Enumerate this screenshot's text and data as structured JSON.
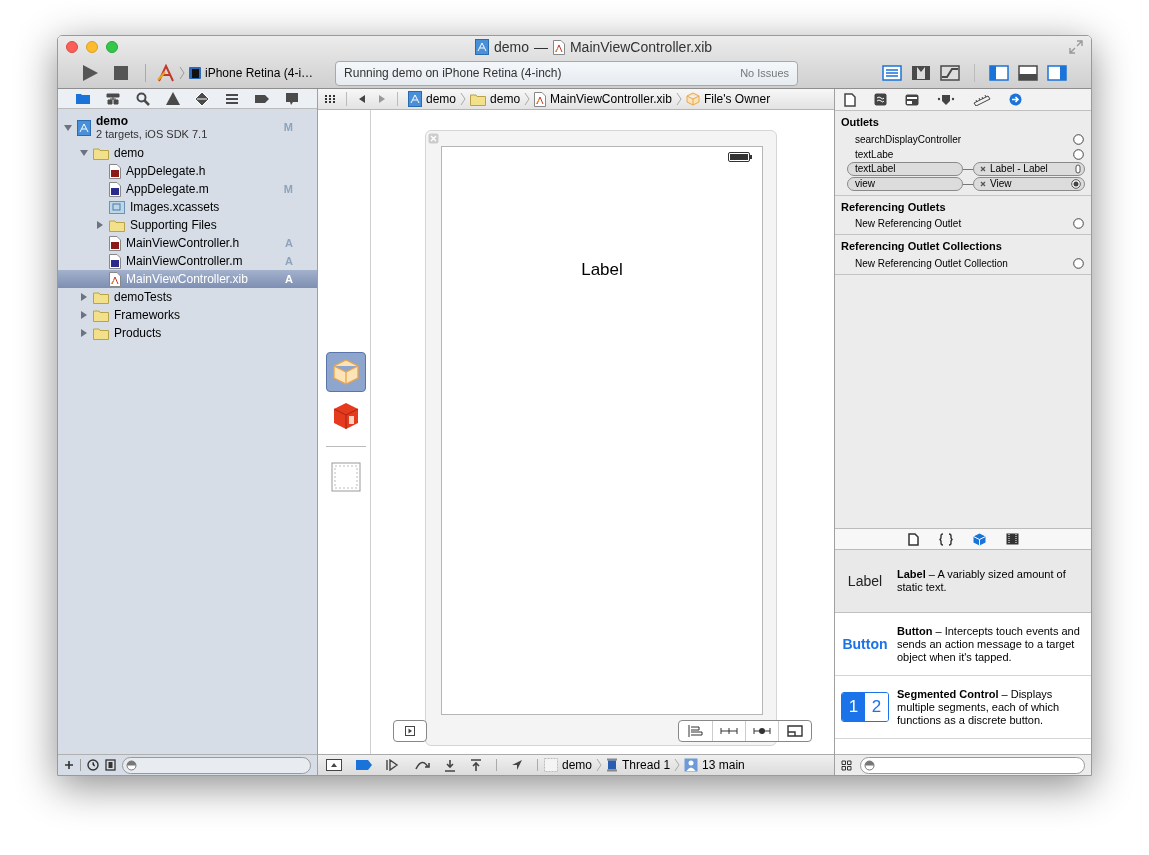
{
  "window": {
    "project": "demo",
    "separator": "—",
    "file": "MainViewController.xib"
  },
  "toolbar": {
    "scheme": "iPhone Retina (4-i…",
    "status": "Running demo on iPhone Retina (4-inch)",
    "issues": "No Issues",
    "editor_modes": [
      {
        "kind": "standard",
        "selected": true
      },
      {
        "kind": "assistant",
        "selected": false
      },
      {
        "kind": "version",
        "selected": false
      }
    ],
    "view_toggles": [
      {
        "kind": "navigator",
        "on": true
      },
      {
        "kind": "debug",
        "on": false
      },
      {
        "kind": "utilities",
        "on": true
      }
    ]
  },
  "navigator": {
    "tabs": [
      {
        "kind": "folder",
        "selected": true
      },
      {
        "kind": "hierarchy",
        "selected": false
      },
      {
        "kind": "search",
        "selected": false
      },
      {
        "kind": "warning",
        "selected": false
      },
      {
        "kind": "test",
        "selected": false
      },
      {
        "kind": "debug",
        "selected": false
      },
      {
        "kind": "breakpoint",
        "selected": false
      },
      {
        "kind": "log",
        "selected": false
      }
    ],
    "tree": [
      {
        "kind": "project",
        "name": "demo",
        "subtitle": "2 targets, iOS SDK 7.1",
        "badge": "M",
        "expanded": true,
        "selected": false,
        "children": [
          {
            "kind": "folder",
            "name": "demo",
            "expanded": true,
            "selected": false,
            "children": [
              {
                "kind": "h",
                "name": "AppDelegate.h",
                "selected": false
              },
              {
                "kind": "m",
                "name": "AppDelegate.m",
                "badge": "M",
                "selected": false
              },
              {
                "kind": "assets",
                "name": "Images.xcassets",
                "selected": false
              },
              {
                "kind": "folder",
                "name": "Supporting Files",
                "expanded": false,
                "selected": false
              },
              {
                "kind": "h",
                "name": "MainViewController.h",
                "badge": "A",
                "selected": false
              },
              {
                "kind": "m",
                "name": "MainViewController.m",
                "badge": "A",
                "selected": false
              },
              {
                "kind": "xib",
                "name": "MainViewController.xib",
                "badge": "A",
                "selected": true
              }
            ]
          },
          {
            "kind": "folder",
            "name": "demoTests",
            "expanded": false,
            "selected": false
          },
          {
            "kind": "folder",
            "name": "Frameworks",
            "expanded": false,
            "selected": false
          },
          {
            "kind": "folder",
            "name": "Products",
            "expanded": false,
            "selected": false
          }
        ]
      }
    ]
  },
  "jump_bar": [
    {
      "kind": "project",
      "label": "demo"
    },
    {
      "kind": "folder",
      "label": "demo"
    },
    {
      "kind": "xib",
      "label": "MainViewController.xib"
    },
    {
      "kind": "owner",
      "label": "File's Owner"
    }
  ],
  "dock": [
    {
      "kind": "owner",
      "selected": true
    },
    {
      "kind": "responder",
      "selected": false
    },
    {
      "kind": "view",
      "selected": false
    }
  ],
  "canvas": {
    "label": "Label"
  },
  "inspector": {
    "tabs": [
      {
        "kind": "file",
        "selected": false
      },
      {
        "kind": "quick-help",
        "selected": false
      },
      {
        "kind": "identity",
        "selected": false
      },
      {
        "kind": "attributes",
        "selected": false
      },
      {
        "kind": "size",
        "selected": false
      },
      {
        "kind": "connections",
        "selected": true
      }
    ],
    "sections": [
      {
        "title": "Outlets",
        "rows": [
          {
            "name": "searchDisplayController"
          },
          {
            "name": "textLabe"
          },
          {
            "name": "textLabel",
            "target": "Label - Label"
          },
          {
            "name": "view",
            "target": "View"
          }
        ]
      },
      {
        "title": "Referencing Outlets",
        "rows": [
          {
            "name": "New Referencing Outlet"
          }
        ]
      },
      {
        "title": "Referencing Outlet Collections",
        "rows": [
          {
            "name": "New Referencing Outlet Collection"
          }
        ]
      }
    ]
  },
  "library": {
    "separator": "–",
    "tabs": [
      {
        "kind": "file",
        "selected": false
      },
      {
        "kind": "code",
        "selected": false
      },
      {
        "kind": "object",
        "selected": true
      },
      {
        "kind": "media",
        "selected": false
      }
    ],
    "items": [
      {
        "kind": "label",
        "preview": "Label",
        "title": "Label",
        "description": "A variably sized amount of static text.",
        "selected": true
      },
      {
        "kind": "button",
        "preview": "Button",
        "title": "Button",
        "description": "Intercepts touch events and sends an action message to a target object when it's tapped.",
        "selected": false
      },
      {
        "kind": "segmented",
        "segments": [
          "1",
          "2"
        ],
        "title": "Segmented Control",
        "description": "Displays multiple segments, each of which functions as a discrete button.",
        "selected": false
      }
    ]
  },
  "debug_bar": {
    "breakpoints_active": true,
    "crumbs": [
      {
        "kind": "app",
        "label": "demo"
      },
      {
        "kind": "thread",
        "label": "Thread 1"
      },
      {
        "kind": "frame",
        "label": "13 main"
      }
    ]
  }
}
